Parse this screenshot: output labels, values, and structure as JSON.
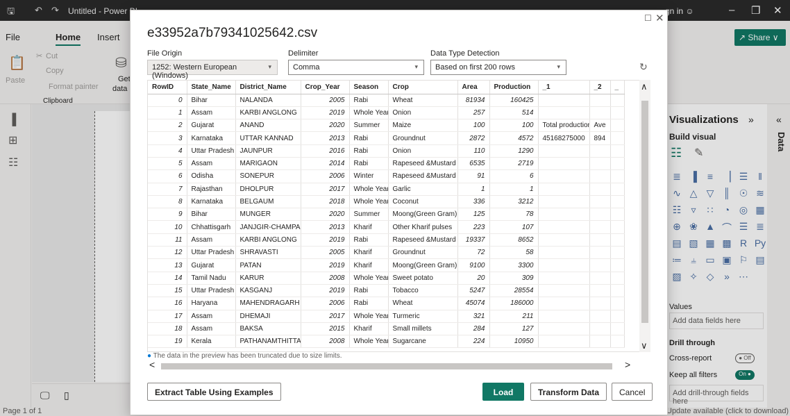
{
  "window": {
    "title": "Untitled - Power BI",
    "signin": "in",
    "share_label": "Share"
  },
  "menu": {
    "file": "File",
    "home": "Home",
    "insert": "Insert"
  },
  "ribbon": {
    "paste": "Paste",
    "cut": "Cut",
    "copy": "Copy",
    "format_painter": "Format painter",
    "clipboard": "Clipboard",
    "get_data_1": "Get",
    "get_data_2": "data"
  },
  "dialog": {
    "title": "e33952a7b79341025642.csv",
    "file_origin_label": "File Origin",
    "file_origin_value": "1252: Western European (Windows)",
    "delimiter_label": "Delimiter",
    "delimiter_value": "Comma",
    "detection_label": "Data Type Detection",
    "detection_value": "Based on first 200 rows",
    "info_text": "The data in the preview has been truncated due to size limits.",
    "extract_label": "Extract Table Using Examples",
    "load_label": "Load",
    "transform_label": "Transform Data",
    "cancel_label": "Cancel"
  },
  "table": {
    "columns": [
      "RowID",
      "State_Name",
      "District_Name",
      "Crop_Year",
      "Season",
      "Crop",
      "Area",
      "Production",
      "_1",
      "_2",
      "_"
    ],
    "rows": [
      [
        "0",
        "Bihar",
        "NALANDA",
        "2005",
        "Rabi",
        "Wheat",
        "81934",
        "160425",
        "",
        "",
        ""
      ],
      [
        "1",
        "Assam",
        "KARBI ANGLONG",
        "2019",
        "Whole Year",
        "Onion",
        "257",
        "514",
        "",
        "",
        ""
      ],
      [
        "2",
        "Gujarat",
        "ANAND",
        "2020",
        "Summer",
        "Maize",
        "100",
        "100",
        "Total production",
        "Ave",
        ""
      ],
      [
        "3",
        "Karnataka",
        "UTTAR KANNAD",
        "2013",
        "Rabi",
        "Groundnut",
        "2872",
        "4572",
        "45168275000",
        "894",
        ""
      ],
      [
        "4",
        "Uttar Pradesh",
        "JAUNPUR",
        "2016",
        "Rabi",
        "Onion",
        "110",
        "1290",
        "",
        "",
        ""
      ],
      [
        "5",
        "Assam",
        "MARIGAON",
        "2014",
        "Rabi",
        "Rapeseed &Mustard",
        "6535",
        "2719",
        "",
        "",
        ""
      ],
      [
        "6",
        "Odisha",
        "SONEPUR",
        "2006",
        "Winter",
        "Rapeseed &Mustard",
        "91",
        "6",
        "",
        "",
        ""
      ],
      [
        "7",
        "Rajasthan",
        "DHOLPUR",
        "2017",
        "Whole Year",
        "Garlic",
        "1",
        "1",
        "",
        "",
        ""
      ],
      [
        "8",
        "Karnataka",
        "BELGAUM",
        "2018",
        "Whole Year",
        "Coconut",
        "336",
        "3212",
        "",
        "",
        ""
      ],
      [
        "9",
        "Bihar",
        "MUNGER",
        "2020",
        "Summer",
        "Moong(Green Gram)",
        "125",
        "78",
        "",
        "",
        ""
      ],
      [
        "10",
        "Chhattisgarh",
        "JANJGIR-CHAMPA",
        "2013",
        "Kharif",
        "Other Kharif pulses",
        "223",
        "107",
        "",
        "",
        ""
      ],
      [
        "11",
        "Assam",
        "KARBI ANGLONG",
        "2019",
        "Rabi",
        "Rapeseed &Mustard",
        "19337",
        "8652",
        "",
        "",
        ""
      ],
      [
        "12",
        "Uttar Pradesh",
        "SHRAVASTI",
        "2005",
        "Kharif",
        "Groundnut",
        "72",
        "58",
        "",
        "",
        ""
      ],
      [
        "13",
        "Gujarat",
        "PATAN",
        "2019",
        "Kharif",
        "Moong(Green Gram)",
        "9100",
        "3300",
        "",
        "",
        ""
      ],
      [
        "14",
        "Tamil Nadu",
        "KARUR",
        "2008",
        "Whole Year",
        "Sweet potato",
        "20",
        "309",
        "",
        "",
        ""
      ],
      [
        "15",
        "Uttar Pradesh",
        "KASGANJ",
        "2019",
        "Rabi",
        "Tobacco",
        "5247",
        "28554",
        "",
        "",
        ""
      ],
      [
        "16",
        "Haryana",
        "MAHENDRAGARH",
        "2006",
        "Rabi",
        "Wheat",
        "45074",
        "186000",
        "",
        "",
        ""
      ],
      [
        "17",
        "Assam",
        "DHEMAJI",
        "2017",
        "Whole Year",
        "Turmeric",
        "321",
        "211",
        "",
        "",
        ""
      ],
      [
        "18",
        "Assam",
        "BAKSA",
        "2015",
        "Kharif",
        "Small millets",
        "284",
        "127",
        "",
        "",
        ""
      ],
      [
        "19",
        "Kerala",
        "PATHANAMTHITTA",
        "2008",
        "Whole Year",
        "Sugarcane",
        "224",
        "10950",
        "",
        "",
        ""
      ]
    ]
  },
  "viz": {
    "title": "Visualizations",
    "build_visual": "Build visual",
    "values": "Values",
    "add_data": "Add data fields here",
    "drill_through": "Drill through",
    "cross_report": "Cross-report",
    "off": "Off",
    "keep_filters": "Keep all filters",
    "on": "On",
    "add_drill": "Add drill-through fields here",
    "data_tab": "Data"
  },
  "status": {
    "page": "Page 1 of 1",
    "update": "Update available (click to download)",
    "tab": "Pa"
  }
}
